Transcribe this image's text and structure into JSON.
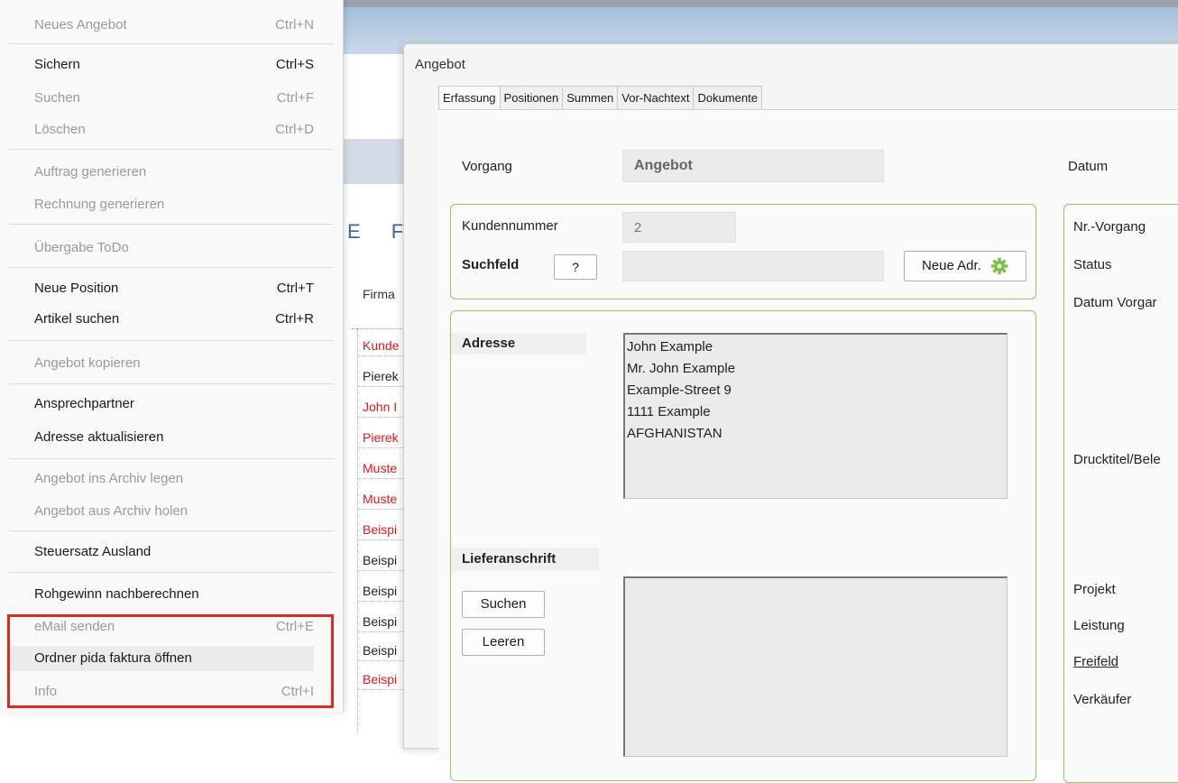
{
  "menu": {
    "items": [
      {
        "label": "Neues Angebot",
        "shortcut": "Ctrl+N",
        "disabled": true
      },
      {
        "label": "Sichern",
        "shortcut": "Ctrl+S",
        "disabled": false
      },
      {
        "label": "Suchen",
        "shortcut": "Ctrl+F",
        "disabled": true
      },
      {
        "label": "Löschen",
        "shortcut": "Ctrl+D",
        "disabled": true
      },
      {
        "label": "Auftrag generieren",
        "shortcut": "",
        "disabled": true
      },
      {
        "label": "Rechnung generieren",
        "shortcut": "",
        "disabled": true
      },
      {
        "label": "Übergabe ToDo",
        "shortcut": "",
        "disabled": true
      },
      {
        "label": "Neue Position",
        "shortcut": "Ctrl+T",
        "disabled": false
      },
      {
        "label": "Artikel suchen",
        "shortcut": "Ctrl+R",
        "disabled": false
      },
      {
        "label": "Angebot kopieren",
        "shortcut": "",
        "disabled": true
      },
      {
        "label": "Ansprechpartner",
        "shortcut": "",
        "disabled": false
      },
      {
        "label": "Adresse aktualisieren",
        "shortcut": "",
        "disabled": false
      },
      {
        "label": "Angebot ins Archiv legen",
        "shortcut": "",
        "disabled": true
      },
      {
        "label": "Angebot aus Archiv holen",
        "shortcut": "",
        "disabled": true
      },
      {
        "label": "Steuersatz Ausland",
        "shortcut": "",
        "disabled": false
      },
      {
        "label": "Rohgewinn nachberechnen",
        "shortcut": "",
        "disabled": false
      },
      {
        "label": "eMail senden",
        "shortcut": "Ctrl+E",
        "disabled": true
      },
      {
        "label": "Ordner pida faktura öffnen",
        "shortcut": "",
        "disabled": false
      },
      {
        "label": "Info",
        "shortcut": "Ctrl+I",
        "disabled": true
      }
    ]
  },
  "background": {
    "heading": "E F",
    "column_header": "Firma",
    "rows": [
      {
        "text": "Kunde",
        "color": "red"
      },
      {
        "text": "Pierek",
        "color": "dark"
      },
      {
        "text": "John I",
        "color": "red"
      },
      {
        "text": "Pierek",
        "color": "red"
      },
      {
        "text": "Muste",
        "color": "red"
      },
      {
        "text": "Muste",
        "color": "red"
      },
      {
        "text": "Beispi",
        "color": "red"
      },
      {
        "text": "Beispi",
        "color": "dark"
      },
      {
        "text": "Beispi",
        "color": "dark"
      },
      {
        "text": "Beispi",
        "color": "dark"
      },
      {
        "text": "Beispi",
        "color": "dark"
      },
      {
        "text": "Beispi",
        "color": "red"
      }
    ]
  },
  "dialog": {
    "title": "Angebot",
    "tabs": [
      "Erfassung",
      "Positionen",
      "Summen",
      "Vor-Nachtext",
      "Dokumente"
    ],
    "vorgang_label": "Vorgang",
    "vorgang_value": "Angebot",
    "datum_label": "Datum",
    "kundennummer_label": "Kundennummer",
    "kundennummer_value": "2",
    "suchfeld_label": "Suchfeld",
    "help_button": "?",
    "neue_adr_button": "Neue Adr.",
    "adresse_label": "Adresse",
    "adresse_lines": [
      "John Example",
      "Mr. John Example",
      "Example-Street 9",
      "1111 Example",
      "AFGHANISTAN"
    ],
    "lieferanschrift_label": "Lieferanschrift",
    "suchen_button": "Suchen",
    "leeren_button": "Leeren",
    "right_labels": {
      "nr_vorgang": "Nr.-Vorgang",
      "status": "Status",
      "datum_vorgang": "Datum Vorgar",
      "drucktitel": "Drucktitel/Bele",
      "projekt": "Projekt",
      "leistung": "Leistung",
      "freifeld": "Freifeld",
      "verkaeufer": "Verkäufer"
    }
  },
  "colors": {
    "highlight_box": "#e02a1f",
    "group_border": "#8cc96a",
    "disabled_text": "#9a9a9a",
    "red_row": "#e01818",
    "gear": "#7ac143"
  }
}
